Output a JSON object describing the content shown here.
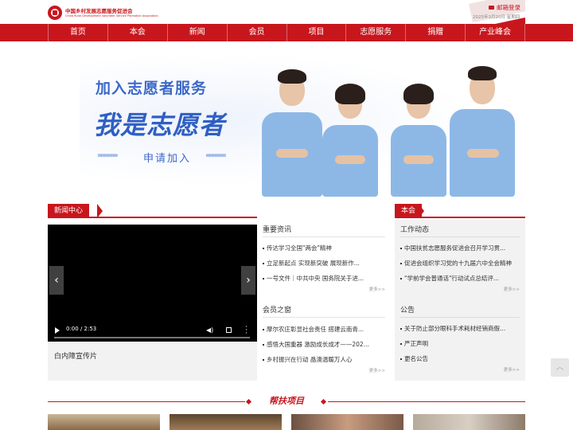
{
  "header": {
    "logo_cn": "中国乡村发展志愿服务促进会",
    "logo_en": "China Rural Development Volunteer Service Promotion Association",
    "mail_label": "邮箱登录",
    "date": "2025年3月20日 星期四"
  },
  "nav": {
    "items": [
      {
        "label": "首页"
      },
      {
        "label": "本会"
      },
      {
        "label": "新闻"
      },
      {
        "label": "会员"
      },
      {
        "label": "项目"
      },
      {
        "label": "志愿服务"
      },
      {
        "label": "捐赠"
      },
      {
        "label": "产业峰会"
      }
    ]
  },
  "banner": {
    "title": "加入志愿者服务",
    "slogan": "我是志愿者",
    "apply": "申请加入",
    "colors": {
      "primary": "#3c68c9",
      "shirt": "#8db8e6"
    }
  },
  "news": {
    "tag": "新闻中心",
    "video": {
      "time": "0:00 / 2:53",
      "caption": "白内障宣传片",
      "prev_icon": "chevron-left-icon",
      "next_icon": "chevron-right-icon"
    },
    "important": {
      "title": "重要资讯",
      "items": [
        {
          "text": "传达学习全国\"两会\"精神"
        },
        {
          "text": "立足新起点 实现新突破 展现新作..."
        },
        {
          "text": "一号文件｜中共中央 国务院关于进..."
        }
      ],
      "more": "更多>>"
    },
    "members": {
      "title": "会员之窗",
      "items": [
        {
          "text": "摩尔农庄彰显社会责任 搭建云南青..."
        },
        {
          "text": "感悟大国重器 激励成长成才——202..."
        },
        {
          "text": "乡村振兴在行动 晶澳温暖万人心"
        }
      ],
      "more": "更多>>"
    }
  },
  "side": {
    "tag": "本会",
    "work": {
      "title": "工作动态",
      "items": [
        {
          "text": "中国扶贫志愿服务促进会召开学习贯..."
        },
        {
          "text": "促进会组织学习党的十九届六中全会精神"
        },
        {
          "text": "\"学前学会普通话\"行动试点总结评..."
        }
      ],
      "more": "更多>>"
    },
    "notice": {
      "title": "公告",
      "items": [
        {
          "text": "关于防止部分眼科手术耗材经销商假..."
        },
        {
          "text": "严正声明"
        },
        {
          "text": "更名公告"
        }
      ],
      "more": "更多>>"
    }
  },
  "projects": {
    "title": "帮扶项目"
  },
  "theme": {
    "red": "#c8161d",
    "panel_bg": "#f2f2f2"
  }
}
